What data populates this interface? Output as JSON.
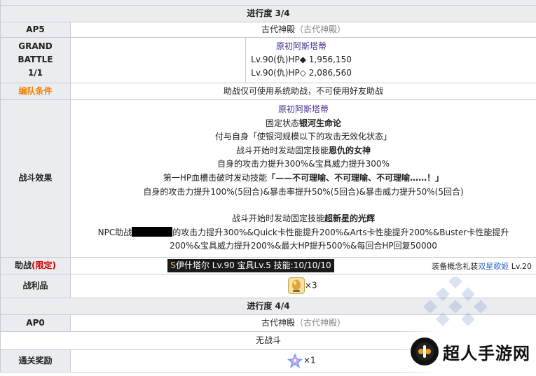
{
  "progress_3": {
    "label": "进行度 3/4"
  },
  "ap5_row": {
    "label": "AP5",
    "location": "古代神殿",
    "location_paren": "（古代神殿）"
  },
  "grand_battle": {
    "label_line1": "GRAND",
    "label_line2": "BATTLE",
    "label_line3": "1/1",
    "enemy_name": "原初阿斯塔蒂",
    "hp_line1": "Lv.90(仇)HP◆ 1,956,150",
    "hp_line2": "Lv.90(仇)HP◇ 2,086,560"
  },
  "team_condition": {
    "label": "编队条件",
    "text": "助战仅可使用系统助战，不可使用好友助战"
  },
  "battle_effect": {
    "label": "战斗效果",
    "enemy_name": "原初阿斯塔蒂",
    "line1_pre": "固定状态",
    "line1_bold": "银河生命论",
    "line2": "付与自身「使银河规模以下的攻击无效化状态」",
    "line3_pre": "战斗开始时发动固定技能",
    "line3_bold": "恩仇的女神",
    "line4": "自身的攻击力提升300%&宝具威力提升300%",
    "line5_pre": "第一HP血槽击破时发动技能",
    "line5_bold": "「——不可理喻、不可理喻、不可理喻……！」",
    "line6": "自身的攻击力提升100%(5回合)&暴击率提升50%(5回合)&暴击威力提升50%(5回合)",
    "line7_pre": "战斗开始时发动固定技能",
    "line7_bold": "超新星的光辉",
    "line8_pre": "NPC助战",
    "line8_post": "的攻击力提升300%&Quick卡性能提升200%&Arts卡性能提升200%&Buster卡性能提升",
    "line9": "200%&宝具威力提升200%&最大HP提升500%&每回合HP回复50000"
  },
  "support": {
    "label": "助战",
    "label_tag": "(限定)",
    "servant_s": "S",
    "servant": "伊什塔尔 Lv.90 宝具Lv.5 技能:10/10/10",
    "ce_pre": "装备概念礼装",
    "ce_name": "双星歌姬",
    "ce_level": "Lv.20"
  },
  "loot": {
    "label": "战利品",
    "count": "×3"
  },
  "progress_4": {
    "label": "进行度 4/4"
  },
  "ap0_row": {
    "label": "AP0",
    "location": "古代神殿",
    "location_paren": "（古代神殿）"
  },
  "no_battle": {
    "text": "无战斗"
  },
  "clear_reward": {
    "label": "通关奖励",
    "count": "×1"
  },
  "watermark": {
    "text": "超人手游网"
  },
  "colors": {
    "header_bg": "#eaecf0",
    "border": "#c8ccd1",
    "orange": "#f08000",
    "red": "#d00000",
    "link": "#3366cc"
  }
}
